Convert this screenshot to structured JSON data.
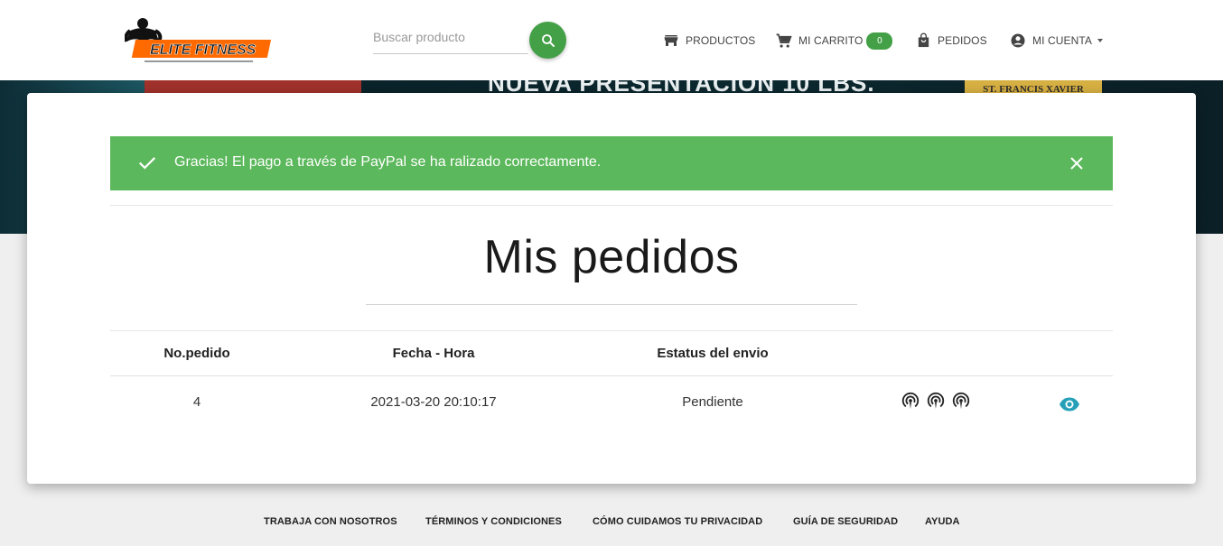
{
  "header": {
    "logo_text": "ELITE FITNESS",
    "search": {
      "placeholder": "Buscar producto",
      "value": ""
    },
    "nav": {
      "productos": "PRODUCTOS",
      "carrito": "MI CARRITO",
      "carrito_count": "0",
      "pedidos": "PEDIDOS",
      "cuenta": "MI CUENTA"
    }
  },
  "banner": {
    "title": "NUEVA PRESENTACIÓN 10 LBS.",
    "gold_text": "ST. FRANCIS XAVIER"
  },
  "alert": {
    "message": "Gracias! El pago a través de PayPal se ha ralizado correctamente.",
    "color": "#5cb85c"
  },
  "page_title": "Mis pedidos",
  "table": {
    "headers": [
      "No.pedido",
      "Fecha - Hora",
      "Estatus del envio"
    ],
    "rows": [
      {
        "numero": "4",
        "fecha": "2021-03-20 20:10:17",
        "estatus": "Pendiente",
        "status_icons": [
          "podcast-icon",
          "podcast-icon",
          "podcast-icon"
        ],
        "action_icon": "eye-icon"
      }
    ]
  },
  "footer": {
    "links": [
      "TRABAJA CON NOSOTROS",
      "TÉRMINOS Y CONDICIONES",
      "CÓMO CUIDAMOS TU PRIVACIDAD",
      "GUÍA DE SEGURIDAD",
      "AYUDA"
    ]
  },
  "colors": {
    "accent_green": "#43a047",
    "eye_teal": "#26a0b8"
  }
}
